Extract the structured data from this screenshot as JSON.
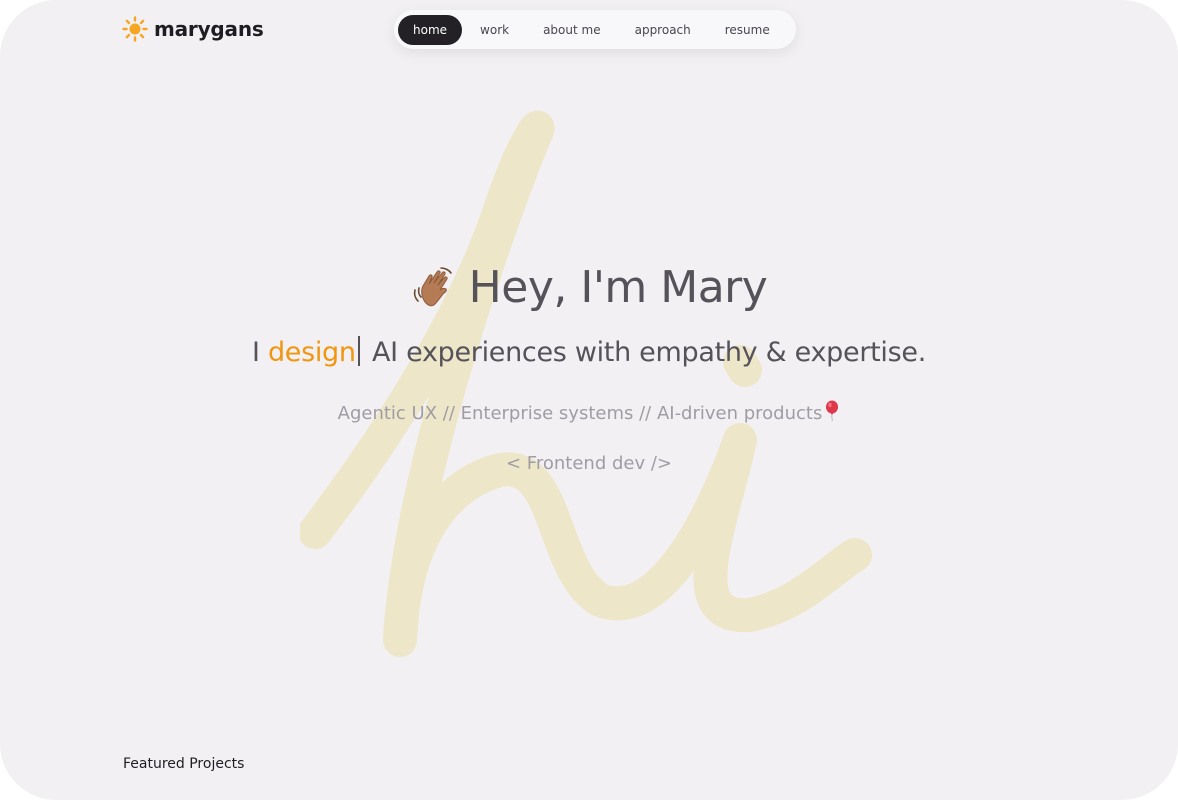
{
  "brand": {
    "name": "marygans",
    "icon": "sun-icon",
    "color": "#f5a623"
  },
  "nav": {
    "items": [
      {
        "label": "home",
        "active": true
      },
      {
        "label": "work",
        "active": false
      },
      {
        "label": "about me",
        "active": false
      },
      {
        "label": "approach",
        "active": false
      },
      {
        "label": "resume",
        "active": false
      }
    ]
  },
  "hero": {
    "background_word": "hi",
    "greeting_icon": "waving-hand-icon",
    "greeting": "Hey, I'm Mary",
    "tagline_prefix": "I ",
    "tagline_accent": "design",
    "tagline_suffix": " AI experiences with empathy & expertise.",
    "specialties": "Agentic UX // Enterprise systems // AI-driven products",
    "specialties_icon": "balloon-icon",
    "frontend": "< Frontend dev />"
  },
  "sections": {
    "featured_title": "Featured Projects"
  },
  "colors": {
    "accent": "#f0960f",
    "background": "#f2f0f3",
    "text": "#55525a",
    "muted": "#a09ca4",
    "scribble": "#ede6c8"
  }
}
